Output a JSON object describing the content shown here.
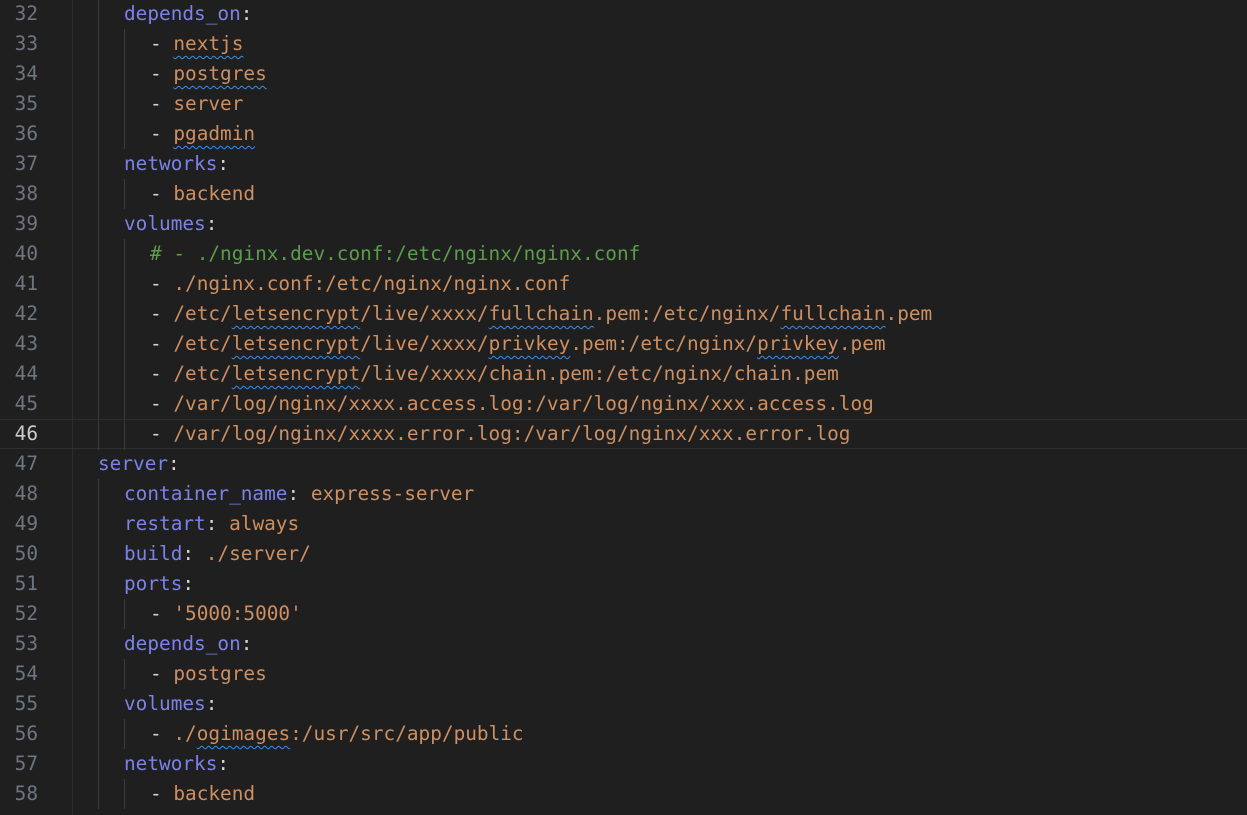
{
  "editor": {
    "current_line": "46",
    "lines": [
      {
        "number": "32",
        "tokens": [
          {
            "t": "depends_on",
            "c": "k"
          },
          {
            "t": ":",
            "c": "p"
          }
        ]
      },
      {
        "number": "33",
        "tokens": [
          {
            "t": "- ",
            "c": "p"
          },
          {
            "t": "nextjs",
            "c": "v",
            "sq": true
          }
        ]
      },
      {
        "number": "34",
        "tokens": [
          {
            "t": "- ",
            "c": "p"
          },
          {
            "t": "postgres",
            "c": "v",
            "sq": true
          }
        ]
      },
      {
        "number": "35",
        "tokens": [
          {
            "t": "- ",
            "c": "p"
          },
          {
            "t": "server",
            "c": "v"
          }
        ]
      },
      {
        "number": "36",
        "tokens": [
          {
            "t": "- ",
            "c": "p"
          },
          {
            "t": "pgadmin",
            "c": "v",
            "sq": true
          }
        ]
      },
      {
        "number": "37",
        "tokens": [
          {
            "t": "networks",
            "c": "k"
          },
          {
            "t": ":",
            "c": "p"
          }
        ]
      },
      {
        "number": "38",
        "tokens": [
          {
            "t": "- ",
            "c": "p"
          },
          {
            "t": "backend",
            "c": "v"
          }
        ]
      },
      {
        "number": "39",
        "tokens": [
          {
            "t": "volumes",
            "c": "k"
          },
          {
            "t": ":",
            "c": "p"
          }
        ]
      },
      {
        "number": "40",
        "tokens": [
          {
            "t": "# - ./nginx.dev.conf:/etc/nginx/nginx.conf",
            "c": "c"
          }
        ]
      },
      {
        "number": "41",
        "tokens": [
          {
            "t": "- ",
            "c": "p"
          },
          {
            "t": "./nginx.conf:/etc/nginx/nginx.conf",
            "c": "v"
          }
        ]
      },
      {
        "number": "42",
        "tokens": [
          {
            "t": "- ",
            "c": "p"
          },
          {
            "t": "/etc/",
            "c": "v"
          },
          {
            "t": "letsencrypt",
            "c": "v",
            "sq": true
          },
          {
            "t": "/live/xxxx/",
            "c": "v"
          },
          {
            "t": "fullchain",
            "c": "v",
            "sq": true
          },
          {
            "t": ".pem:/etc/nginx/",
            "c": "v"
          },
          {
            "t": "fullchain",
            "c": "v",
            "sq": true
          },
          {
            "t": ".pem",
            "c": "v"
          }
        ]
      },
      {
        "number": "43",
        "tokens": [
          {
            "t": "- ",
            "c": "p"
          },
          {
            "t": "/etc/",
            "c": "v"
          },
          {
            "t": "letsencrypt",
            "c": "v",
            "sq": true
          },
          {
            "t": "/live/xxxx/",
            "c": "v"
          },
          {
            "t": "privkey",
            "c": "v",
            "sq": true
          },
          {
            "t": ".pem:/etc/nginx/",
            "c": "v"
          },
          {
            "t": "privkey",
            "c": "v",
            "sq": true
          },
          {
            "t": ".pem",
            "c": "v"
          }
        ]
      },
      {
        "number": "44",
        "tokens": [
          {
            "t": "- ",
            "c": "p"
          },
          {
            "t": "/etc/",
            "c": "v"
          },
          {
            "t": "letsencrypt",
            "c": "v",
            "sq": true
          },
          {
            "t": "/live/xxxx/chain.pem:/etc/nginx/chain.pem",
            "c": "v"
          }
        ]
      },
      {
        "number": "45",
        "tokens": [
          {
            "t": "- ",
            "c": "p"
          },
          {
            "t": "/var/log/nginx/xxxx.access.log:/var/log/nginx/xxx.access.log",
            "c": "v"
          }
        ]
      },
      {
        "number": "46",
        "tokens": [
          {
            "t": "- ",
            "c": "p"
          },
          {
            "t": "/var/log/nginx/xxxx.error.log:/var/log/nginx/xxx.error.log",
            "c": "v"
          }
        ]
      },
      {
        "number": "47",
        "tokens": [
          {
            "t": "server",
            "c": "k"
          },
          {
            "t": ":",
            "c": "p"
          }
        ]
      },
      {
        "number": "48",
        "tokens": [
          {
            "t": "container_name",
            "c": "k"
          },
          {
            "t": ": ",
            "c": "p"
          },
          {
            "t": "express-server",
            "c": "v"
          }
        ]
      },
      {
        "number": "49",
        "tokens": [
          {
            "t": "restart",
            "c": "k"
          },
          {
            "t": ": ",
            "c": "p"
          },
          {
            "t": "always",
            "c": "v"
          }
        ]
      },
      {
        "number": "50",
        "tokens": [
          {
            "t": "build",
            "c": "k"
          },
          {
            "t": ": ",
            "c": "p"
          },
          {
            "t": "./server/",
            "c": "v"
          }
        ]
      },
      {
        "number": "51",
        "tokens": [
          {
            "t": "ports",
            "c": "k"
          },
          {
            "t": ":",
            "c": "p"
          }
        ]
      },
      {
        "number": "52",
        "tokens": [
          {
            "t": "- ",
            "c": "p"
          },
          {
            "t": "'5000:5000'",
            "c": "v"
          }
        ]
      },
      {
        "number": "53",
        "tokens": [
          {
            "t": "depends_on",
            "c": "k"
          },
          {
            "t": ":",
            "c": "p"
          }
        ]
      },
      {
        "number": "54",
        "tokens": [
          {
            "t": "- ",
            "c": "p"
          },
          {
            "t": "postgres",
            "c": "v"
          }
        ]
      },
      {
        "number": "55",
        "tokens": [
          {
            "t": "volumes",
            "c": "k"
          },
          {
            "t": ":",
            "c": "p"
          }
        ]
      },
      {
        "number": "56",
        "tokens": [
          {
            "t": "- ",
            "c": "p"
          },
          {
            "t": "./",
            "c": "v"
          },
          {
            "t": "ogimages",
            "c": "v",
            "sq": true
          },
          {
            "t": ":/usr/src/app/public",
            "c": "v"
          }
        ]
      },
      {
        "number": "57",
        "tokens": [
          {
            "t": "networks",
            "c": "k"
          },
          {
            "t": ":",
            "c": "p"
          }
        ]
      },
      {
        "number": "58",
        "tokens": [
          {
            "t": "- ",
            "c": "p"
          },
          {
            "t": "backend",
            "c": "v"
          }
        ]
      }
    ]
  },
  "colors": {
    "background": "#1f1f1f",
    "line_number": "#6e7681",
    "line_number_active": "#cccccc",
    "key": "#7b82e9",
    "value": "#ce8f61",
    "comment": "#5a9e4a",
    "squiggle": "#3a8ee6"
  }
}
